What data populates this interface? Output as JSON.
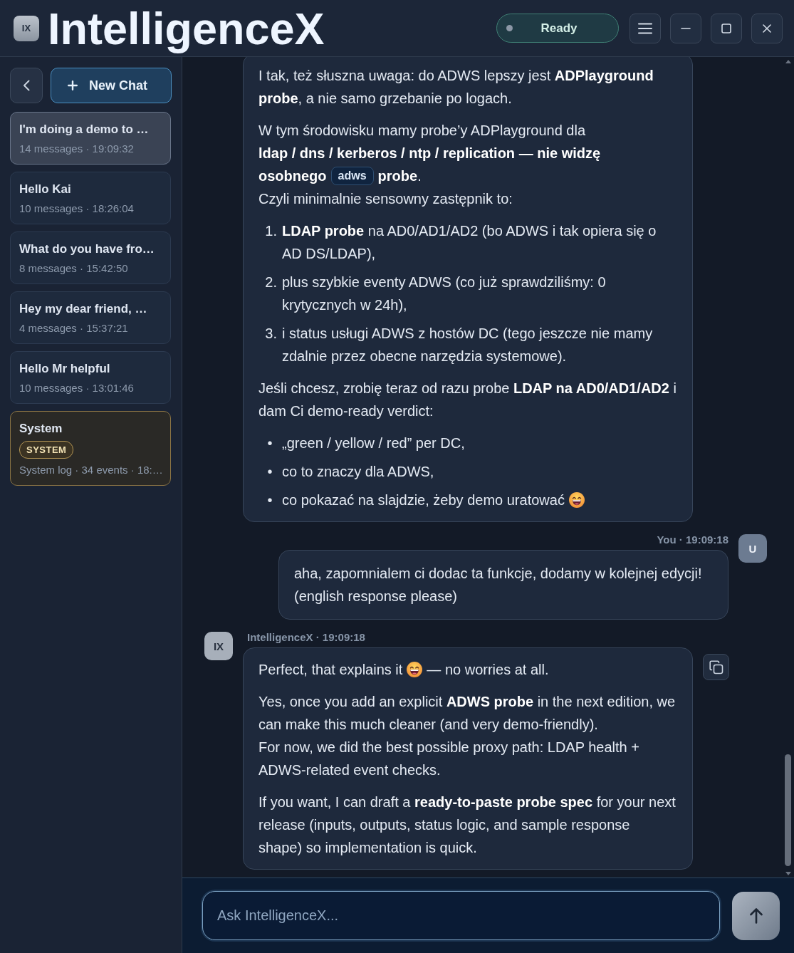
{
  "window": {
    "logo": "IX",
    "title": "IntelligenceX",
    "status": {
      "label": "Ready"
    }
  },
  "sidebar": {
    "new_chat": "New Chat",
    "chats": [
      {
        "kind": "chat",
        "title": "I'm doing a demo to …",
        "meta": "14 messages · 19:09:32",
        "selected": true
      },
      {
        "kind": "chat",
        "title": "Hello Kai",
        "meta": "10 messages · 18:26:04",
        "selected": false
      },
      {
        "kind": "chat",
        "title": "What do you have fro…",
        "meta": "8 messages · 15:42:50",
        "selected": false
      },
      {
        "kind": "chat",
        "title": "Hey my dear friend, …",
        "meta": "4 messages · 15:37:21",
        "selected": false
      },
      {
        "kind": "chat",
        "title": "Hello Mr helpful",
        "meta": "10 messages · 13:01:46",
        "selected": false
      },
      {
        "kind": "system",
        "title": "System",
        "badge": "SYSTEM",
        "meta": "System log · 34 events · 18:…",
        "selected": false
      }
    ]
  },
  "messages": [
    {
      "kind": "assistant",
      "blocks": [
        {
          "kind": "p",
          "text": "I tak, też słuszna uwaga: do ADWS lepszy jest **ADPlayground probe**, a nie samo grzebanie po logach."
        },
        {
          "kind": "p",
          "text": "W tym środowisku mamy probe’y ADPlayground dla\n**ldap / dns / kerberos / ntp / replication — nie widzę**"
        },
        {
          "kind": "line",
          "runs": [
            {
              "kind": "text",
              "text": "**osobnego**"
            },
            {
              "kind": "code",
              "text": "adws"
            },
            {
              "kind": "text",
              "text": "**probe**."
            }
          ]
        },
        {
          "kind": "line",
          "text": "Czyli minimalnie sensowny zastępnik to:"
        },
        {
          "kind": "ol",
          "items": [
            {
              "marker": "1.",
              "text": "**LDAP probe** na AD0/AD1/AD2 (bo ADWS i tak opiera się o AD DS/LDAP),"
            },
            {
              "marker": "2.",
              "text": "plus szybkie eventy ADWS (co już sprawdziliśmy: 0 krytycznych w 24h),"
            },
            {
              "marker": "3.",
              "text": "i status usługi ADWS z hostów DC (tego jeszcze nie mamy zdalnie przez obecne narzędzia systemowe)."
            }
          ]
        },
        {
          "kind": "p",
          "text": "Jeśli chcesz, zrobię teraz od razu probe **LDAP na AD0/AD1/AD2** i dam Ci demo-ready verdict:"
        },
        {
          "kind": "ul",
          "items": [
            {
              "marker": "•",
              "text": "„green / yellow / red” per DC,"
            },
            {
              "marker": "•",
              "text": "co to znaczy dla ADWS,"
            },
            {
              "marker": "•",
              "runs": [
                {
                  "kind": "text",
                  "text": "co pokazać na slajdzie, żeby demo uratować"
                },
                {
                  "kind": "emoji"
                }
              ]
            }
          ]
        }
      ]
    },
    {
      "kind": "user",
      "meta": "You · 19:09:18",
      "avatar": "U",
      "blocks": [
        {
          "kind": "p",
          "text": "aha, zapomnialem ci dodac ta funkcje, dodamy w kolejnej edycji! (english response please)"
        }
      ]
    },
    {
      "kind": "assistant",
      "meta": "IntelligenceX · 19:09:18",
      "avatar": "IX",
      "copyable": true,
      "blocks": [
        {
          "kind": "p",
          "runs": [
            {
              "kind": "text",
              "text": "Perfect, that explains it"
            },
            {
              "kind": "emoji"
            },
            {
              "kind": "text",
              "text": "— no worries at all."
            }
          ]
        },
        {
          "kind": "p",
          "text": "Yes, once you add an explicit **ADWS probe** in the next edition, we can make this much cleaner (and very demo-friendly).\nFor now, we did the best possible proxy path: LDAP health + ADWS-related event checks."
        },
        {
          "kind": "p",
          "text": "If you want, I can draft a **ready-to-paste probe spec** for your next release (inputs, outputs, status logic, and sample response shape) so implementation is quick."
        }
      ]
    }
  ],
  "composer": {
    "placeholder": "Ask IntelligenceX..."
  }
}
